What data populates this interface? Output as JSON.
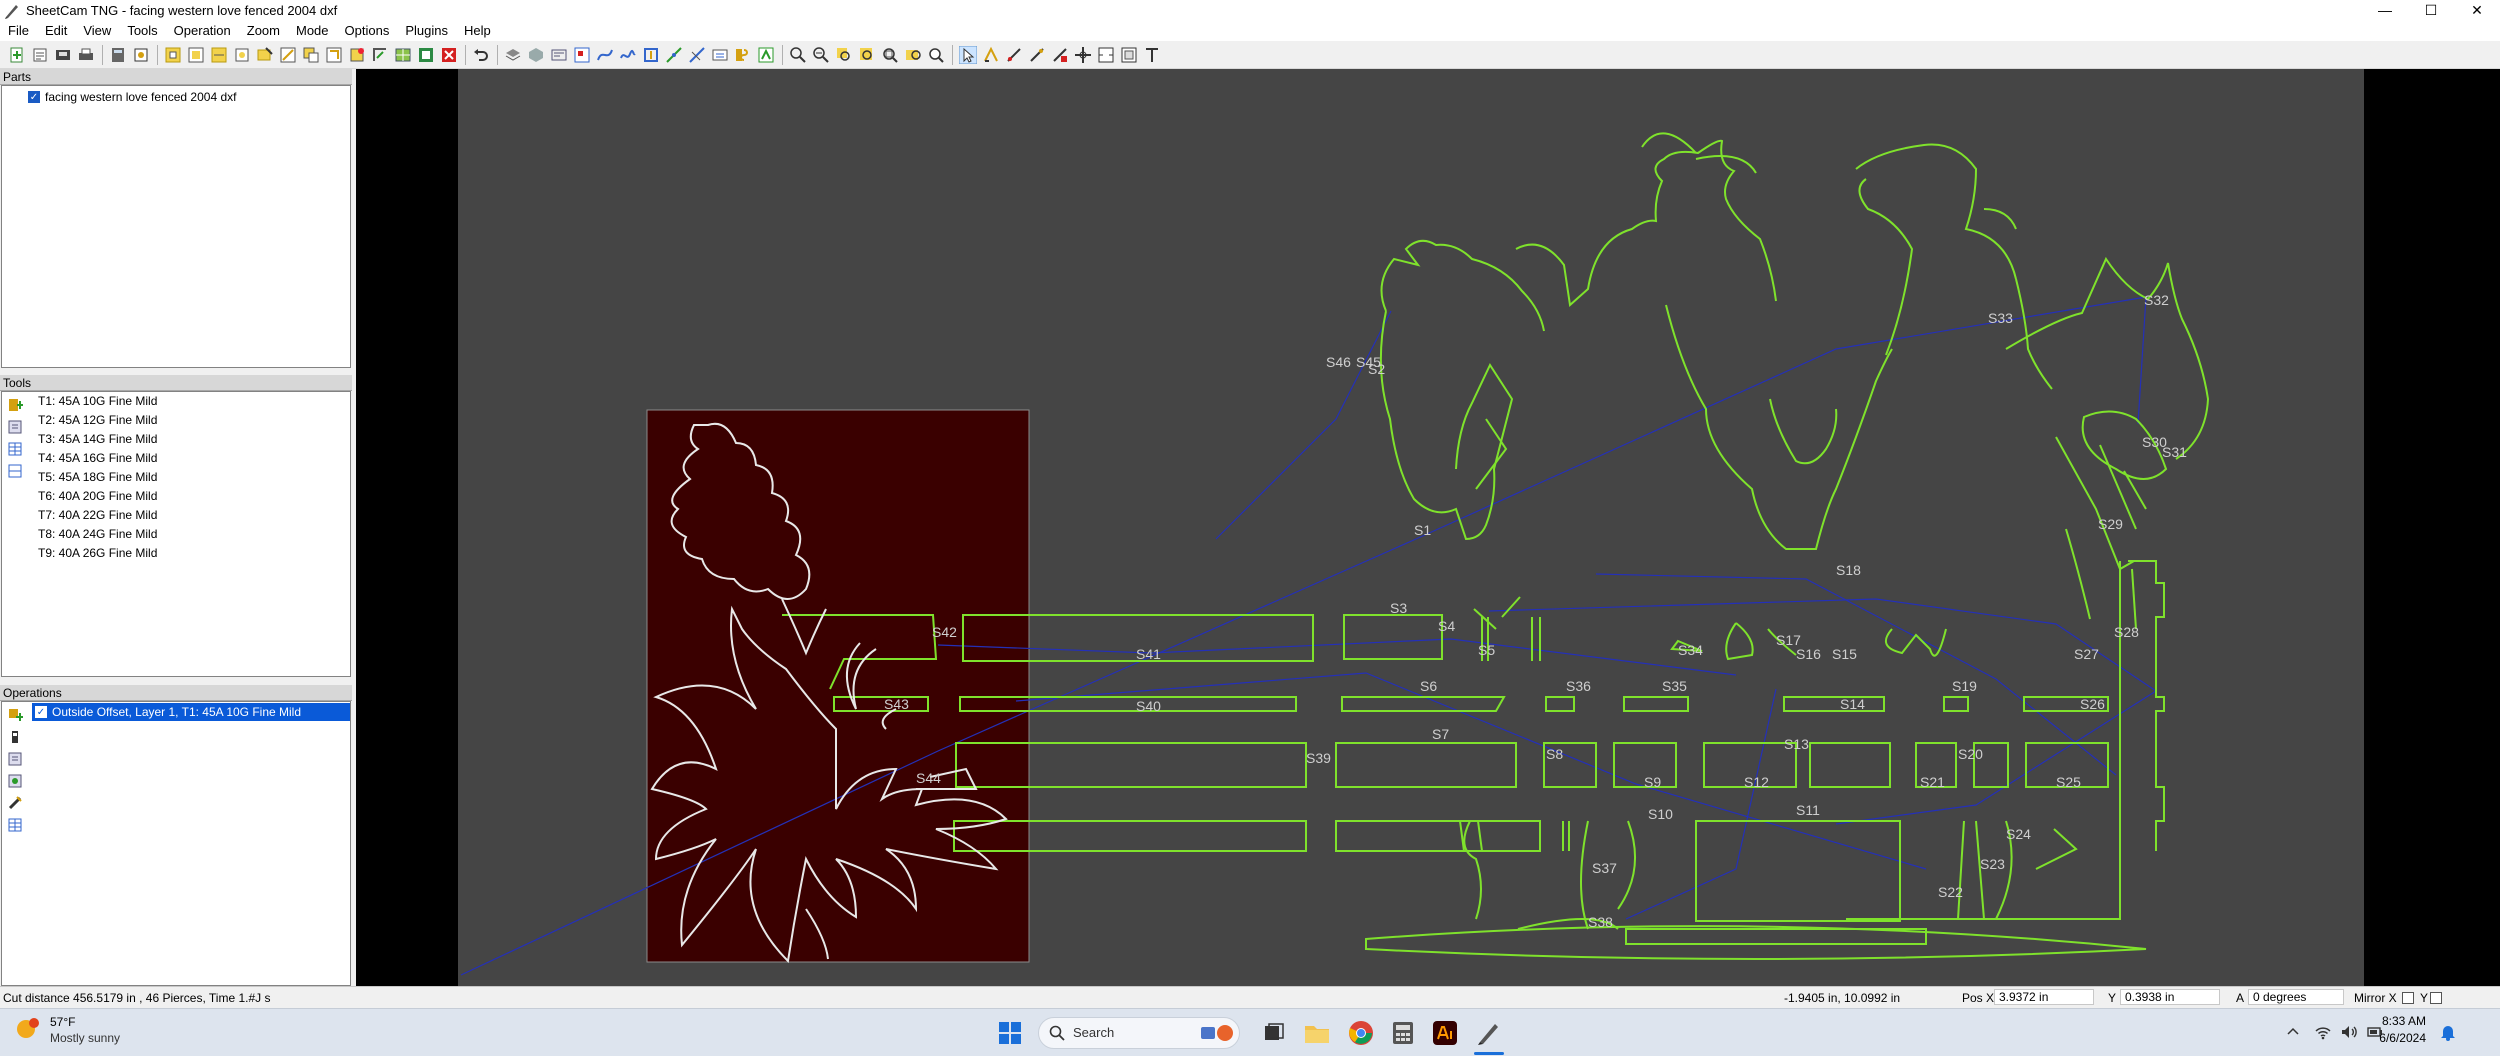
{
  "window": {
    "title": "SheetCam TNG - facing western love fenced 2004 dxf",
    "controls": [
      "—",
      "☐",
      "✕"
    ]
  },
  "menu": [
    "File",
    "Edit",
    "View",
    "Tools",
    "Operation",
    "Zoom",
    "Mode",
    "Options",
    "Plugins",
    "Help"
  ],
  "panels": {
    "parts": {
      "header": "Parts",
      "items": [
        {
          "label": "facing western love fenced 2004 dxf",
          "checked": true
        }
      ]
    },
    "tools": {
      "header": "Tools",
      "items": [
        "T1: 45A 10G Fine Mild",
        "T2: 45A 12G Fine Mild",
        "T3: 45A 14G Fine Mild",
        "T4: 45A 16G Fine Mild",
        "T5: 45A 18G Fine Mild",
        "T6: 40A 20G Fine Mild",
        "T7: 40A 22G Fine Mild",
        "T8: 40A 24G Fine Mild",
        "T9: 40A 26G Fine Mild"
      ]
    },
    "operations": {
      "header": "Operations",
      "items": [
        {
          "label": "Outside Offset, Layer 1, T1: 45A 10G Fine Mild",
          "checked": true,
          "selected": true
        }
      ]
    }
  },
  "canvas": {
    "labels": [
      "S1",
      "S2",
      "S3",
      "S4",
      "S5",
      "S6",
      "S7",
      "S8",
      "S9",
      "S10",
      "S11",
      "S12",
      "S13",
      "S14",
      "S15",
      "S16",
      "S17",
      "S18",
      "S19",
      "S20",
      "S21",
      "S22",
      "S23",
      "S24",
      "S25",
      "S26",
      "S27",
      "S28",
      "S29",
      "S30",
      "S31",
      "S32",
      "S33",
      "S34",
      "S35",
      "S36",
      "S37",
      "S38",
      "S39",
      "S40",
      "S41",
      "S42",
      "S43",
      "S44",
      "S45",
      "S46"
    ],
    "colors": {
      "background": "#454545",
      "outer": "#000000",
      "cut_path": "#7fe22c",
      "rapid": "#2430b8",
      "sheet": "#3a0000"
    }
  },
  "status": {
    "cut_info": "Cut distance 456.5179 in , 46 Pierces, Time 1.#J s",
    "coords": "-1.9405 in, 10.0992 in",
    "pos_x_label": "Pos X",
    "pos_x": "3.9372 in",
    "y_label": "Y",
    "pos_y": "0.3938 in",
    "a_label": "A",
    "angle": "0 degrees",
    "mirror_label": "Mirror X",
    "mirror_y_label": "Y"
  },
  "taskbar": {
    "temperature": "57°F",
    "weather": "Mostly sunny",
    "search": "Search",
    "time": "8:33 AM",
    "date": "6/6/2024"
  }
}
